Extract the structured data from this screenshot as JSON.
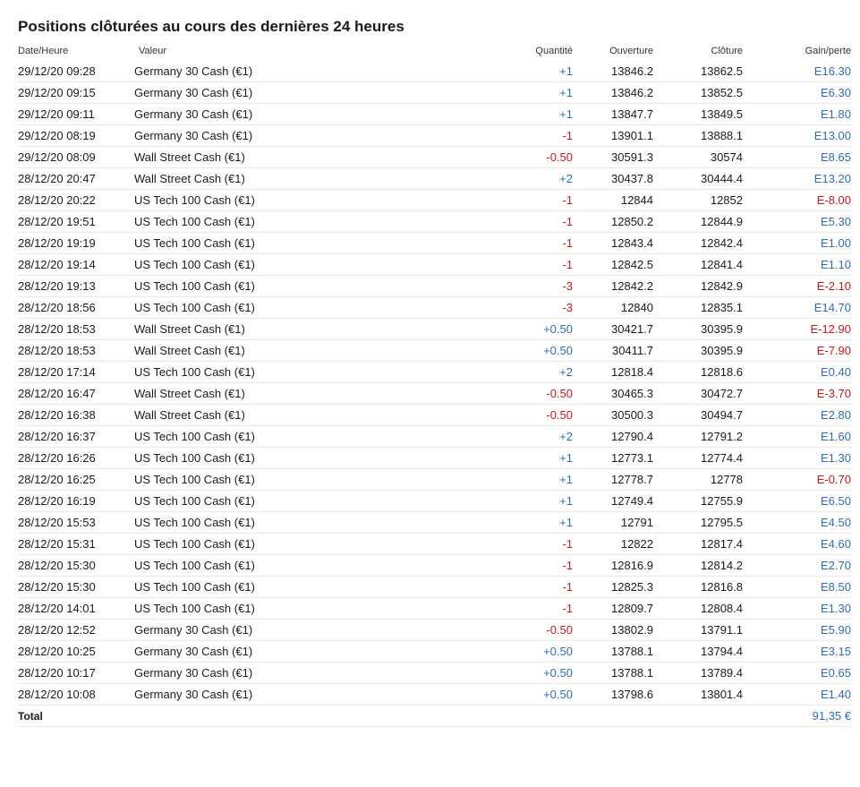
{
  "page": {
    "title": "Positions clôturées au cours des dernières 24 heures"
  },
  "headers": {
    "date": "Date/Heure",
    "value": "Valeur",
    "qty": "Quantité",
    "open": "Ouverture",
    "close": "Clôture",
    "gain": "Gain/perte"
  },
  "colors": {
    "positive": "#2f6db3",
    "negative": "#c8161d"
  },
  "rows": [
    {
      "date": "29/12/20 09:28",
      "value": "Germany 30 Cash (€1)",
      "qty": "+1",
      "open": "13846.2",
      "close": "13862.5",
      "gain": "E16.30"
    },
    {
      "date": "29/12/20 09:15",
      "value": "Germany 30 Cash (€1)",
      "qty": "+1",
      "open": "13846.2",
      "close": "13852.5",
      "gain": "E6.30"
    },
    {
      "date": "29/12/20 09:11",
      "value": "Germany 30 Cash (€1)",
      "qty": "+1",
      "open": "13847.7",
      "close": "13849.5",
      "gain": "E1.80"
    },
    {
      "date": "29/12/20 08:19",
      "value": "Germany 30 Cash (€1)",
      "qty": "-1",
      "open": "13901.1",
      "close": "13888.1",
      "gain": "E13.00"
    },
    {
      "date": "29/12/20 08:09",
      "value": "Wall Street Cash (€1)",
      "qty": "-0.50",
      "open": "30591.3",
      "close": "30574",
      "gain": "E8.65"
    },
    {
      "date": "28/12/20 20:47",
      "value": "Wall Street Cash (€1)",
      "qty": "+2",
      "open": "30437.8",
      "close": "30444.4",
      "gain": "E13.20"
    },
    {
      "date": "28/12/20 20:22",
      "value": "US Tech 100 Cash (€1)",
      "qty": "-1",
      "open": "12844",
      "close": "12852",
      "gain": "E-8.00"
    },
    {
      "date": "28/12/20 19:51",
      "value": "US Tech 100 Cash (€1)",
      "qty": "-1",
      "open": "12850.2",
      "close": "12844.9",
      "gain": "E5.30"
    },
    {
      "date": "28/12/20 19:19",
      "value": "US Tech 100 Cash (€1)",
      "qty": "-1",
      "open": "12843.4",
      "close": "12842.4",
      "gain": "E1.00"
    },
    {
      "date": "28/12/20 19:14",
      "value": "US Tech 100 Cash (€1)",
      "qty": "-1",
      "open": "12842.5",
      "close": "12841.4",
      "gain": "E1.10"
    },
    {
      "date": "28/12/20 19:13",
      "value": "US Tech 100 Cash (€1)",
      "qty": "-3",
      "open": "12842.2",
      "close": "12842.9",
      "gain": "E-2.10"
    },
    {
      "date": "28/12/20 18:56",
      "value": "US Tech 100 Cash (€1)",
      "qty": "-3",
      "open": "12840",
      "close": "12835.1",
      "gain": "E14.70"
    },
    {
      "date": "28/12/20 18:53",
      "value": "Wall Street Cash (€1)",
      "qty": "+0.50",
      "open": "30421.7",
      "close": "30395.9",
      "gain": "E-12.90"
    },
    {
      "date": "28/12/20 18:53",
      "value": "Wall Street Cash (€1)",
      "qty": "+0.50",
      "open": "30411.7",
      "close": "30395.9",
      "gain": "E-7.90"
    },
    {
      "date": "28/12/20 17:14",
      "value": "US Tech 100 Cash (€1)",
      "qty": "+2",
      "open": "12818.4",
      "close": "12818.6",
      "gain": "E0.40"
    },
    {
      "date": "28/12/20 16:47",
      "value": "Wall Street Cash (€1)",
      "qty": "-0.50",
      "open": "30465.3",
      "close": "30472.7",
      "gain": "E-3.70"
    },
    {
      "date": "28/12/20 16:38",
      "value": "Wall Street Cash (€1)",
      "qty": "-0.50",
      "open": "30500.3",
      "close": "30494.7",
      "gain": "E2.80"
    },
    {
      "date": "28/12/20 16:37",
      "value": "US Tech 100 Cash (€1)",
      "qty": "+2",
      "open": "12790.4",
      "close": "12791.2",
      "gain": "E1.60"
    },
    {
      "date": "28/12/20 16:26",
      "value": "US Tech 100 Cash (€1)",
      "qty": "+1",
      "open": "12773.1",
      "close": "12774.4",
      "gain": "E1.30"
    },
    {
      "date": "28/12/20 16:25",
      "value": "US Tech 100 Cash (€1)",
      "qty": "+1",
      "open": "12778.7",
      "close": "12778",
      "gain": "E-0.70"
    },
    {
      "date": "28/12/20 16:19",
      "value": "US Tech 100 Cash (€1)",
      "qty": "+1",
      "open": "12749.4",
      "close": "12755.9",
      "gain": "E6.50"
    },
    {
      "date": "28/12/20 15:53",
      "value": "US Tech 100 Cash (€1)",
      "qty": "+1",
      "open": "12791",
      "close": "12795.5",
      "gain": "E4.50"
    },
    {
      "date": "28/12/20 15:31",
      "value": "US Tech 100 Cash (€1)",
      "qty": "-1",
      "open": "12822",
      "close": "12817.4",
      "gain": "E4.60"
    },
    {
      "date": "28/12/20 15:30",
      "value": "US Tech 100 Cash (€1)",
      "qty": "-1",
      "open": "12816.9",
      "close": "12814.2",
      "gain": "E2.70"
    },
    {
      "date": "28/12/20 15:30",
      "value": "US Tech 100 Cash (€1)",
      "qty": "-1",
      "open": "12825.3",
      "close": "12816.8",
      "gain": "E8.50"
    },
    {
      "date": "28/12/20 14:01",
      "value": "US Tech 100 Cash (€1)",
      "qty": "-1",
      "open": "12809.7",
      "close": "12808.4",
      "gain": "E1.30"
    },
    {
      "date": "28/12/20 12:52",
      "value": "Germany 30 Cash (€1)",
      "qty": "-0.50",
      "open": "13802.9",
      "close": "13791.1",
      "gain": "E5.90"
    },
    {
      "date": "28/12/20 10:25",
      "value": "Germany 30 Cash (€1)",
      "qty": "+0.50",
      "open": "13788.1",
      "close": "13794.4",
      "gain": "E3.15"
    },
    {
      "date": "28/12/20 10:17",
      "value": "Germany 30 Cash (€1)",
      "qty": "+0.50",
      "open": "13788.1",
      "close": "13789.4",
      "gain": "E0.65"
    },
    {
      "date": "28/12/20 10:08",
      "value": "Germany 30 Cash (€1)",
      "qty": "+0.50",
      "open": "13798.6",
      "close": "13801.4",
      "gain": "E1.40"
    }
  ],
  "total": {
    "label": "Total",
    "value": "91,35 €"
  }
}
